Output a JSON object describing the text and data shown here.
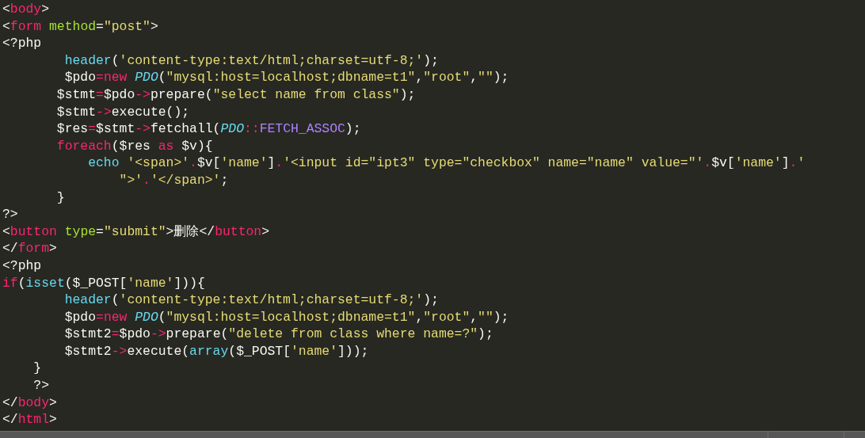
{
  "editor": {
    "lines": [
      [
        {
          "kind": "p",
          "text": "<"
        },
        {
          "kind": "tag",
          "text": "body"
        },
        {
          "kind": "p",
          "text": ">"
        }
      ],
      [
        {
          "kind": "p",
          "text": "<"
        },
        {
          "kind": "tag",
          "text": "form "
        },
        {
          "kind": "attr",
          "text": "method"
        },
        {
          "kind": "p",
          "text": "="
        },
        {
          "kind": "str",
          "text": "\"post\""
        },
        {
          "kind": "p",
          "text": ">"
        }
      ],
      [
        {
          "kind": "p",
          "text": "<?php"
        }
      ],
      [
        {
          "kind": "func",
          "text": "        header"
        },
        {
          "kind": "p",
          "text": "("
        },
        {
          "kind": "str",
          "text": "'content-type:text/html;charset=utf-8;'"
        },
        {
          "kind": "p",
          "text": ");"
        }
      ],
      [
        {
          "kind": "p",
          "text": "        $pdo"
        },
        {
          "kind": "op",
          "text": "="
        },
        {
          "kind": "kw",
          "text": "new "
        },
        {
          "kind": "cls",
          "text": "PDO"
        },
        {
          "kind": "p",
          "text": "("
        },
        {
          "kind": "str",
          "text": "\"mysql:host=localhost;dbname=t1\""
        },
        {
          "kind": "p",
          "text": ","
        },
        {
          "kind": "str",
          "text": "\"root\""
        },
        {
          "kind": "p",
          "text": ","
        },
        {
          "kind": "str",
          "text": "\"\""
        },
        {
          "kind": "p",
          "text": ");"
        }
      ],
      [
        {
          "kind": "p",
          "text": "       $stmt"
        },
        {
          "kind": "op",
          "text": "="
        },
        {
          "kind": "p",
          "text": "$pdo"
        },
        {
          "kind": "op",
          "text": "->"
        },
        {
          "kind": "p",
          "text": "prepare("
        },
        {
          "kind": "str",
          "text": "\"select name from class\""
        },
        {
          "kind": "p",
          "text": ");"
        }
      ],
      [
        {
          "kind": "p",
          "text": "       $stmt"
        },
        {
          "kind": "op",
          "text": "->"
        },
        {
          "kind": "p",
          "text": "execute();"
        }
      ],
      [
        {
          "kind": "p",
          "text": "       $res"
        },
        {
          "kind": "op",
          "text": "="
        },
        {
          "kind": "p",
          "text": "$stmt"
        },
        {
          "kind": "op",
          "text": "->"
        },
        {
          "kind": "p",
          "text": "fetchall("
        },
        {
          "kind": "cls",
          "text": "PDO"
        },
        {
          "kind": "op",
          "text": "::"
        },
        {
          "kind": "const",
          "text": "FETCH_ASSOC"
        },
        {
          "kind": "p",
          "text": ");"
        }
      ],
      [
        {
          "kind": "kw",
          "text": "       foreach"
        },
        {
          "kind": "p",
          "text": "($res "
        },
        {
          "kind": "kw",
          "text": "as"
        },
        {
          "kind": "p",
          "text": " $v){"
        }
      ],
      [
        {
          "kind": "func",
          "text": "           echo "
        },
        {
          "kind": "str",
          "text": "'<span>'"
        },
        {
          "kind": "op",
          "text": "."
        },
        {
          "kind": "p",
          "text": "$v["
        },
        {
          "kind": "str",
          "text": "'name'"
        },
        {
          "kind": "p",
          "text": "]"
        },
        {
          "kind": "op",
          "text": "."
        },
        {
          "kind": "str",
          "text": "'<input id=\"ipt3\" type=\"checkbox\" name=\"name\" value=\"'"
        },
        {
          "kind": "op",
          "text": "."
        },
        {
          "kind": "p",
          "text": "$v["
        },
        {
          "kind": "str",
          "text": "'name'"
        },
        {
          "kind": "p",
          "text": "]"
        },
        {
          "kind": "op",
          "text": "."
        },
        {
          "kind": "str",
          "text": "'"
        }
      ],
      [
        {
          "kind": "str",
          "text": "               \">'"
        },
        {
          "kind": "op",
          "text": "."
        },
        {
          "kind": "str",
          "text": "'</span>'"
        },
        {
          "kind": "p",
          "text": ";"
        }
      ],
      [
        {
          "kind": "p",
          "text": "       }"
        }
      ],
      [
        {
          "kind": "p",
          "text": "?>"
        }
      ],
      [
        {
          "kind": "p",
          "text": "<"
        },
        {
          "kind": "tag",
          "text": "button "
        },
        {
          "kind": "attr",
          "text": "type"
        },
        {
          "kind": "p",
          "text": "="
        },
        {
          "kind": "str",
          "text": "\"submit\""
        },
        {
          "kind": "p",
          "text": ">删除</"
        },
        {
          "kind": "tag",
          "text": "button"
        },
        {
          "kind": "p",
          "text": ">"
        }
      ],
      [
        {
          "kind": "p",
          "text": "</"
        },
        {
          "kind": "tag",
          "text": "form"
        },
        {
          "kind": "p",
          "text": ">"
        }
      ],
      [
        {
          "kind": "p",
          "text": "<?php"
        }
      ],
      [
        {
          "kind": "kw",
          "text": "if"
        },
        {
          "kind": "p",
          "text": "("
        },
        {
          "kind": "func",
          "text": "isset"
        },
        {
          "kind": "p",
          "text": "($_POST["
        },
        {
          "kind": "str",
          "text": "'name'"
        },
        {
          "kind": "p",
          "text": "])){"
        }
      ],
      [
        {
          "kind": "func",
          "text": "        header"
        },
        {
          "kind": "p",
          "text": "("
        },
        {
          "kind": "str",
          "text": "'content-type:text/html;charset=utf-8;'"
        },
        {
          "kind": "p",
          "text": ");"
        }
      ],
      [
        {
          "kind": "p",
          "text": "        $pdo"
        },
        {
          "kind": "op",
          "text": "="
        },
        {
          "kind": "kw",
          "text": "new "
        },
        {
          "kind": "cls",
          "text": "PDO"
        },
        {
          "kind": "p",
          "text": "("
        },
        {
          "kind": "str",
          "text": "\"mysql:host=localhost;dbname=t1\""
        },
        {
          "kind": "p",
          "text": ","
        },
        {
          "kind": "str",
          "text": "\"root\""
        },
        {
          "kind": "p",
          "text": ","
        },
        {
          "kind": "str",
          "text": "\"\""
        },
        {
          "kind": "p",
          "text": ");"
        }
      ],
      [
        {
          "kind": "p",
          "text": "        $stmt2"
        },
        {
          "kind": "op",
          "text": "="
        },
        {
          "kind": "p",
          "text": "$pdo"
        },
        {
          "kind": "op",
          "text": "->"
        },
        {
          "kind": "p",
          "text": "prepare("
        },
        {
          "kind": "str",
          "text": "\"delete from class where name=?\""
        },
        {
          "kind": "p",
          "text": ");"
        }
      ],
      [
        {
          "kind": "p",
          "text": "        $stmt2"
        },
        {
          "kind": "op",
          "text": "->"
        },
        {
          "kind": "p",
          "text": "execute("
        },
        {
          "kind": "func",
          "text": "array"
        },
        {
          "kind": "p",
          "text": "($_POST["
        },
        {
          "kind": "str",
          "text": "'name'"
        },
        {
          "kind": "p",
          "text": "]));"
        }
      ],
      [
        {
          "kind": "p",
          "text": "    }"
        }
      ],
      [
        {
          "kind": "p",
          "text": "    ?>"
        }
      ],
      [
        {
          "kind": "p",
          "text": "</"
        },
        {
          "kind": "tag",
          "text": "body"
        },
        {
          "kind": "p",
          "text": ">"
        }
      ],
      [
        {
          "kind": "p",
          "text": "</"
        },
        {
          "kind": "tag",
          "text": "html"
        },
        {
          "kind": "p",
          "text": ">"
        }
      ]
    ]
  }
}
